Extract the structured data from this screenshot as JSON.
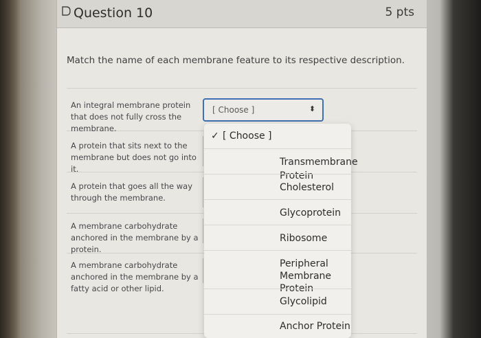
{
  "question": {
    "title": "Question 10",
    "points": "5 pts",
    "prompt": "Match the name of each membrane feature to its respective description."
  },
  "rows": [
    {
      "description": "An integral membrane protein that does not fully cross the membrane."
    },
    {
      "description": "A protein that sits next to the membrane but does not go into it."
    },
    {
      "description": "A protein that goes all the way through the membrane."
    },
    {
      "description": "A membrane carbohydrate anchored in the membrane by a protein."
    },
    {
      "description": "A membrane carbohydrate anchored in the membrane by a fatty acid or other lipid."
    }
  ],
  "select": {
    "value": "[ Choose ]"
  },
  "dropdown": {
    "selected_mark": "✓",
    "options": [
      {
        "label": "[ Choose ]",
        "selected": true
      },
      {
        "label": "Transmembrane Protein"
      },
      {
        "label": "Cholesterol"
      },
      {
        "label": "Glycoprotein"
      },
      {
        "label": "Ribosome"
      },
      {
        "label": "Peripheral Membrane Protein"
      },
      {
        "label": "Glycolipid"
      },
      {
        "label": "Anchor Protein"
      }
    ]
  },
  "colors": {
    "focus_border": "#3f6fb0",
    "panel_bg": "#e9e7e2",
    "header_bg": "#d8d6d0"
  },
  "icons": {
    "question_flag": "flag-outline-icon",
    "select_arrow": "up-down-chevron-icon"
  }
}
